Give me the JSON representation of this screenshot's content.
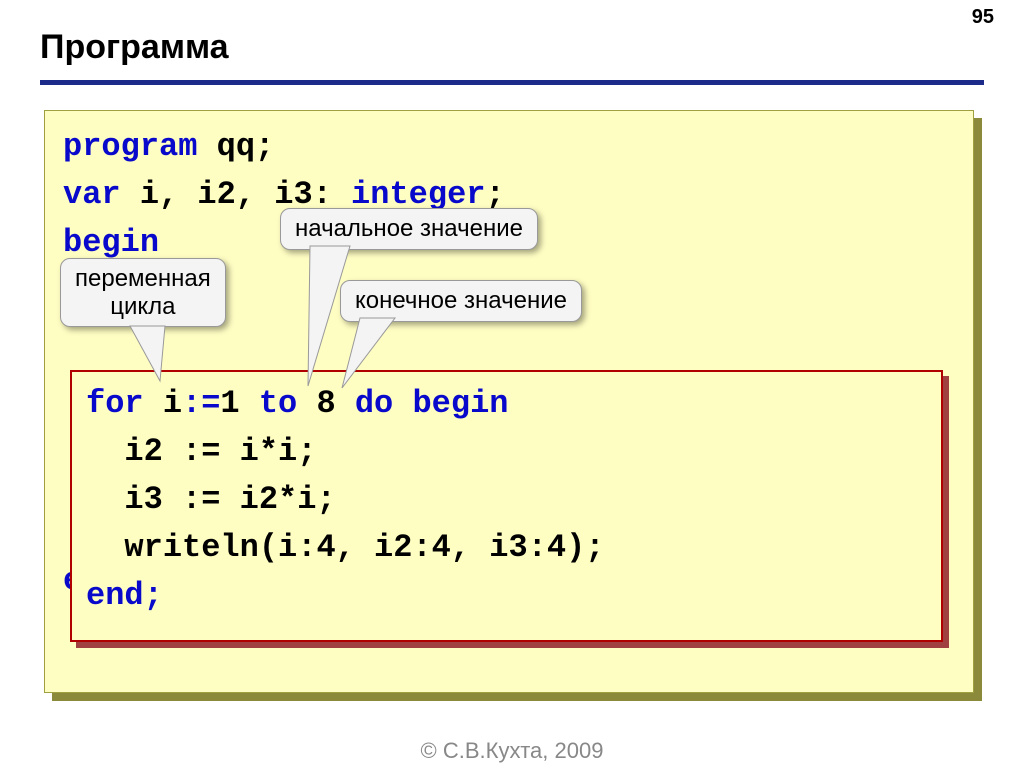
{
  "page_number": "95",
  "title": "Программа",
  "code": {
    "line1_a": "program",
    "line1_b": " qq;",
    "line2_a": "var",
    "line2_b": " i, i2, i3: ",
    "line2_c": "integer",
    "line2_d": ";",
    "line3": "begin",
    "inner1_a": "for ",
    "inner1_b": "i",
    "inner1_c": ":=",
    "inner1_d": "1",
    "inner1_e": " to ",
    "inner1_f": "8",
    "inner1_g": " do begin",
    "inner2": "  i2 := i*i;",
    "inner3": "  i3 := i2*i;",
    "inner4": "  writeln(i:4, i2:4, i3:4);",
    "inner5": "end;",
    "line_end": "end."
  },
  "callouts": {
    "loop_var": "переменная\nцикла",
    "start_val": "начальное значение",
    "end_val": "конечное значение"
  },
  "footer": "© С.В.Кухта, 2009"
}
